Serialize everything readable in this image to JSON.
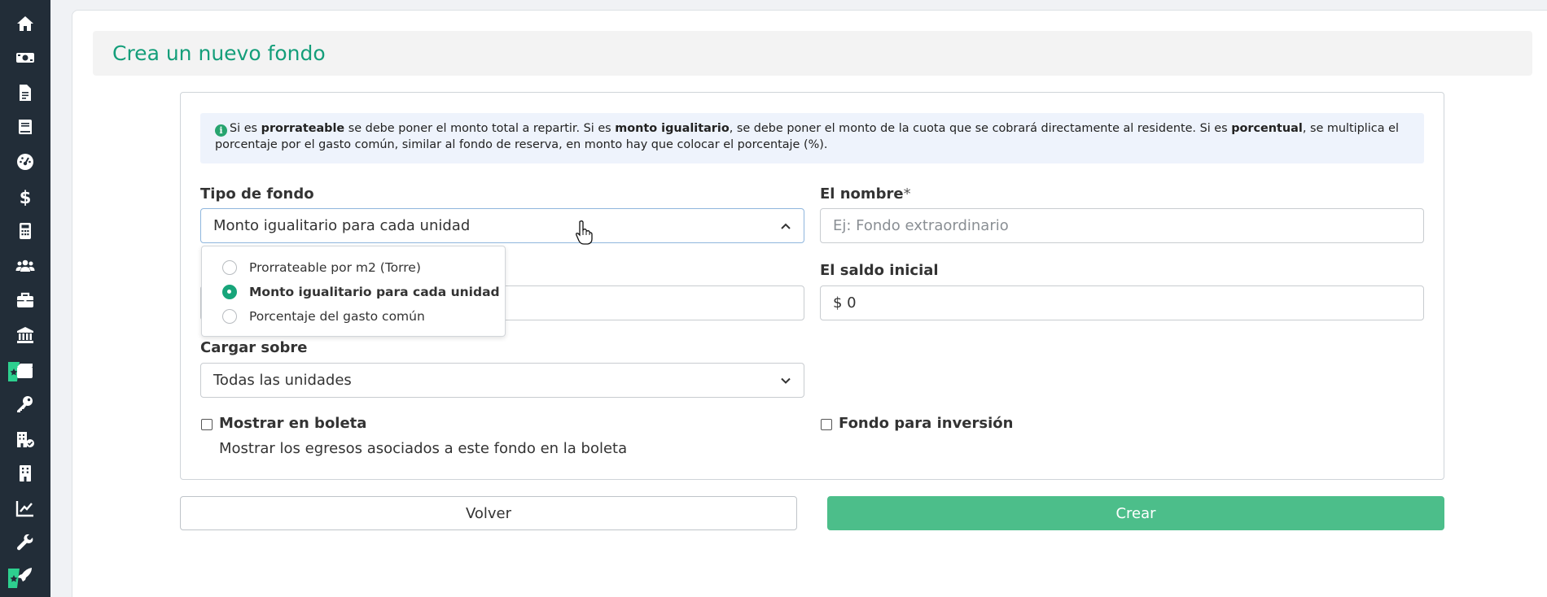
{
  "page": {
    "title": "Crea un nuevo fondo"
  },
  "info": {
    "segments": [
      {
        "t": "Si es ",
        "b": false
      },
      {
        "t": "prorrateable",
        "b": true
      },
      {
        "t": " se debe poner el monto total a repartir. Si es ",
        "b": false
      },
      {
        "t": "monto igualitario",
        "b": true
      },
      {
        "t": ", se debe poner el monto de la cuota que se cobrará directamente al residente. Si es ",
        "b": false
      },
      {
        "t": "porcentual",
        "b": true
      },
      {
        "t": ", se multiplica el porcentaje por el gasto común, similar al fondo de reserva, en monto hay que colocar el porcentaje (%).",
        "b": false
      }
    ]
  },
  "form": {
    "tipo_label": "Tipo de fondo",
    "tipo_value": "Monto igualitario para cada unidad",
    "nombre_label": "El nombre",
    "nombre_required": "*",
    "nombre_placeholder": "Ej: Fondo extraordinario",
    "saldo_label": "El saldo inicial",
    "saldo_value": "$ 0",
    "cargar_label": "Cargar sobre",
    "cargar_value": "Todas las unidades",
    "mostrar_label": "Mostrar en boleta",
    "mostrar_help": "Mostrar los egresos asociados a este fondo en la boleta",
    "inversion_label": "Fondo para inversión"
  },
  "dropdown": {
    "options": [
      {
        "label": "Prorrateable por m2 (Torre)",
        "selected": false
      },
      {
        "label": "Monto igualitario para cada unidad",
        "selected": true
      },
      {
        "label": "Porcentaje del gasto común",
        "selected": false
      }
    ]
  },
  "buttons": {
    "back": "Volver",
    "create": "Crear"
  },
  "sidebar": {
    "icons": [
      "home-icon",
      "money-icon",
      "document-icon",
      "book-icon",
      "dashboard-icon",
      "dollar-icon",
      "calculator-icon",
      "users-icon",
      "briefcase-icon",
      "bank-icon",
      "new-feature-icon",
      "key-icon",
      "building-icon",
      "office-building-icon",
      "chart-line-icon",
      "wrench-icon",
      "rocket-feature-icon"
    ]
  },
  "colors": {
    "accent": "#149e7a",
    "create_button": "#4cbe8a",
    "sidebar": "#222d38"
  }
}
